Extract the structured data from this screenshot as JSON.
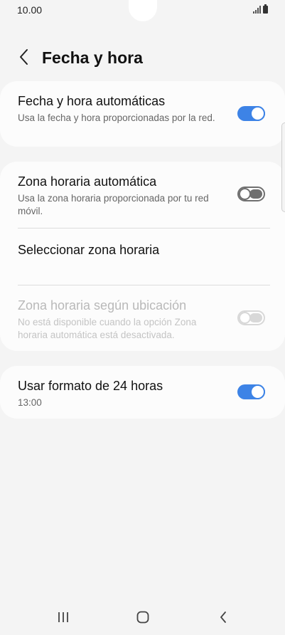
{
  "status_bar": {
    "time": "10.00",
    "icons": [
      "signal-icon",
      "battery-icon"
    ]
  },
  "header": {
    "title": "Fecha y hora",
    "back_icon": "chevron-left-icon"
  },
  "settings": {
    "auto_datetime": {
      "title": "Fecha y hora automáticas",
      "subtitle": "Usa la fecha y hora proporcionadas por la red.",
      "toggle": "on"
    },
    "auto_timezone": {
      "title": "Zona horaria automática",
      "subtitle": "Usa la zona horaria proporcionada por tu red móvil.",
      "toggle": "off"
    },
    "select_timezone": {
      "title": "Seleccionar zona horaria"
    },
    "location_timezone": {
      "title": "Zona horaria según ubicación",
      "subtitle": "No está disponible cuando la opción Zona horaria automática está desactivada.",
      "toggle": "disabled"
    },
    "format_24h": {
      "title": "Usar formato de 24 horas",
      "subtitle": "13:00",
      "toggle": "on"
    }
  },
  "colors": {
    "accent": "#3d83e6",
    "background": "#f4f4f4",
    "card": "#fcfcfc",
    "disabled_text": "#b9b9b9"
  },
  "nav_bar": {
    "icons": [
      "recents-icon",
      "home-icon",
      "back-icon"
    ]
  }
}
